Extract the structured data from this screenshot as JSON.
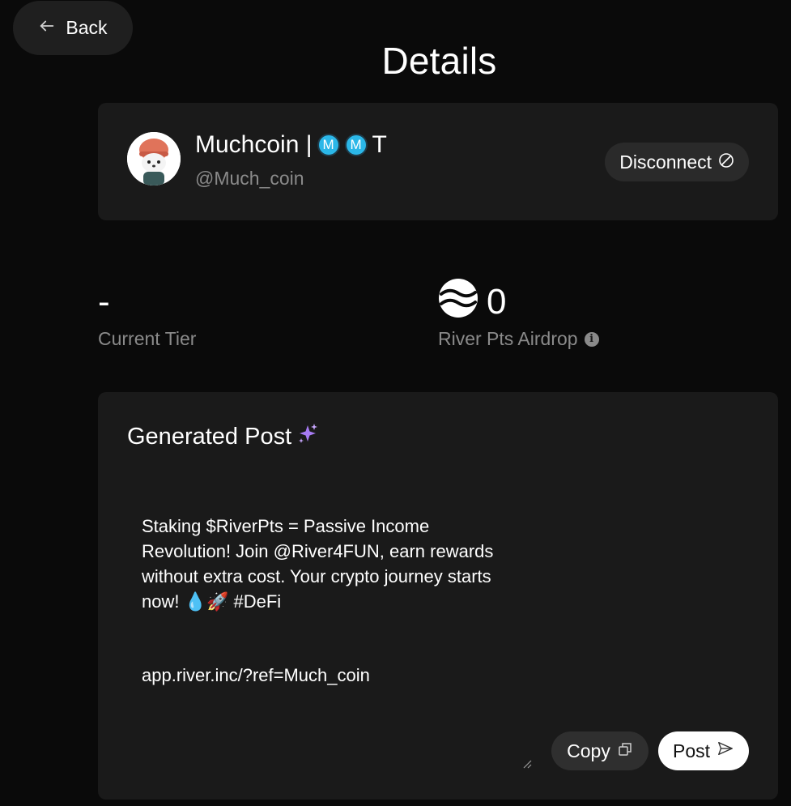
{
  "nav": {
    "back_label": "Back"
  },
  "page": {
    "title": "Details"
  },
  "profile": {
    "name_prefix": "Muchcoin |",
    "badge_1": "M",
    "badge_2": "M",
    "name_suffix": "T",
    "handle": "@Much_coin",
    "disconnect_label": "Disconnect"
  },
  "stats": {
    "tier_value": "-",
    "tier_label": "Current Tier",
    "airdrop_value": "0",
    "airdrop_label": "River Pts Airdrop",
    "info_glyph": "i"
  },
  "post": {
    "title": "Generated Post",
    "text": "Staking $RiverPts = Passive Income Revolution! Join @River4FUN, earn rewards without extra cost. Your crypto journey starts now! 💧🚀 #DeFi",
    "link": "app.river.inc/?ref=Much_coin",
    "copy_label": "Copy",
    "post_label": "Post"
  },
  "colors": {
    "background": "#0a0a0a",
    "card": "#1a1a1a",
    "muted_text": "#8a8a8a",
    "badge": "#2bb7e8",
    "sparkle": "#a77bf3"
  }
}
